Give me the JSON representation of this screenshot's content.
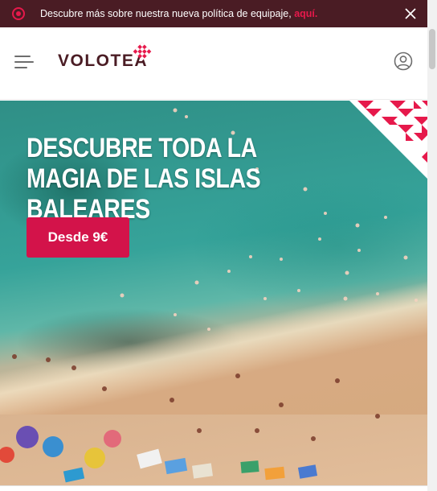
{
  "announcement": {
    "text": "Descubre más sobre nuestra nueva política de equipaje,",
    "link_text": "aquí."
  },
  "header": {
    "logo_text": "VOLOTEA",
    "menu_icon": "hamburger-menu-icon",
    "account_icon": "user-account-icon"
  },
  "hero": {
    "title": "DESCUBRE TODA LA MAGIA DE LAS ISLAS BALEARES",
    "cta_label": "Desde 9€"
  },
  "colors": {
    "brand_dark": "#4a1c24",
    "brand_accent": "#e6194b",
    "cta": "#d3134a"
  }
}
